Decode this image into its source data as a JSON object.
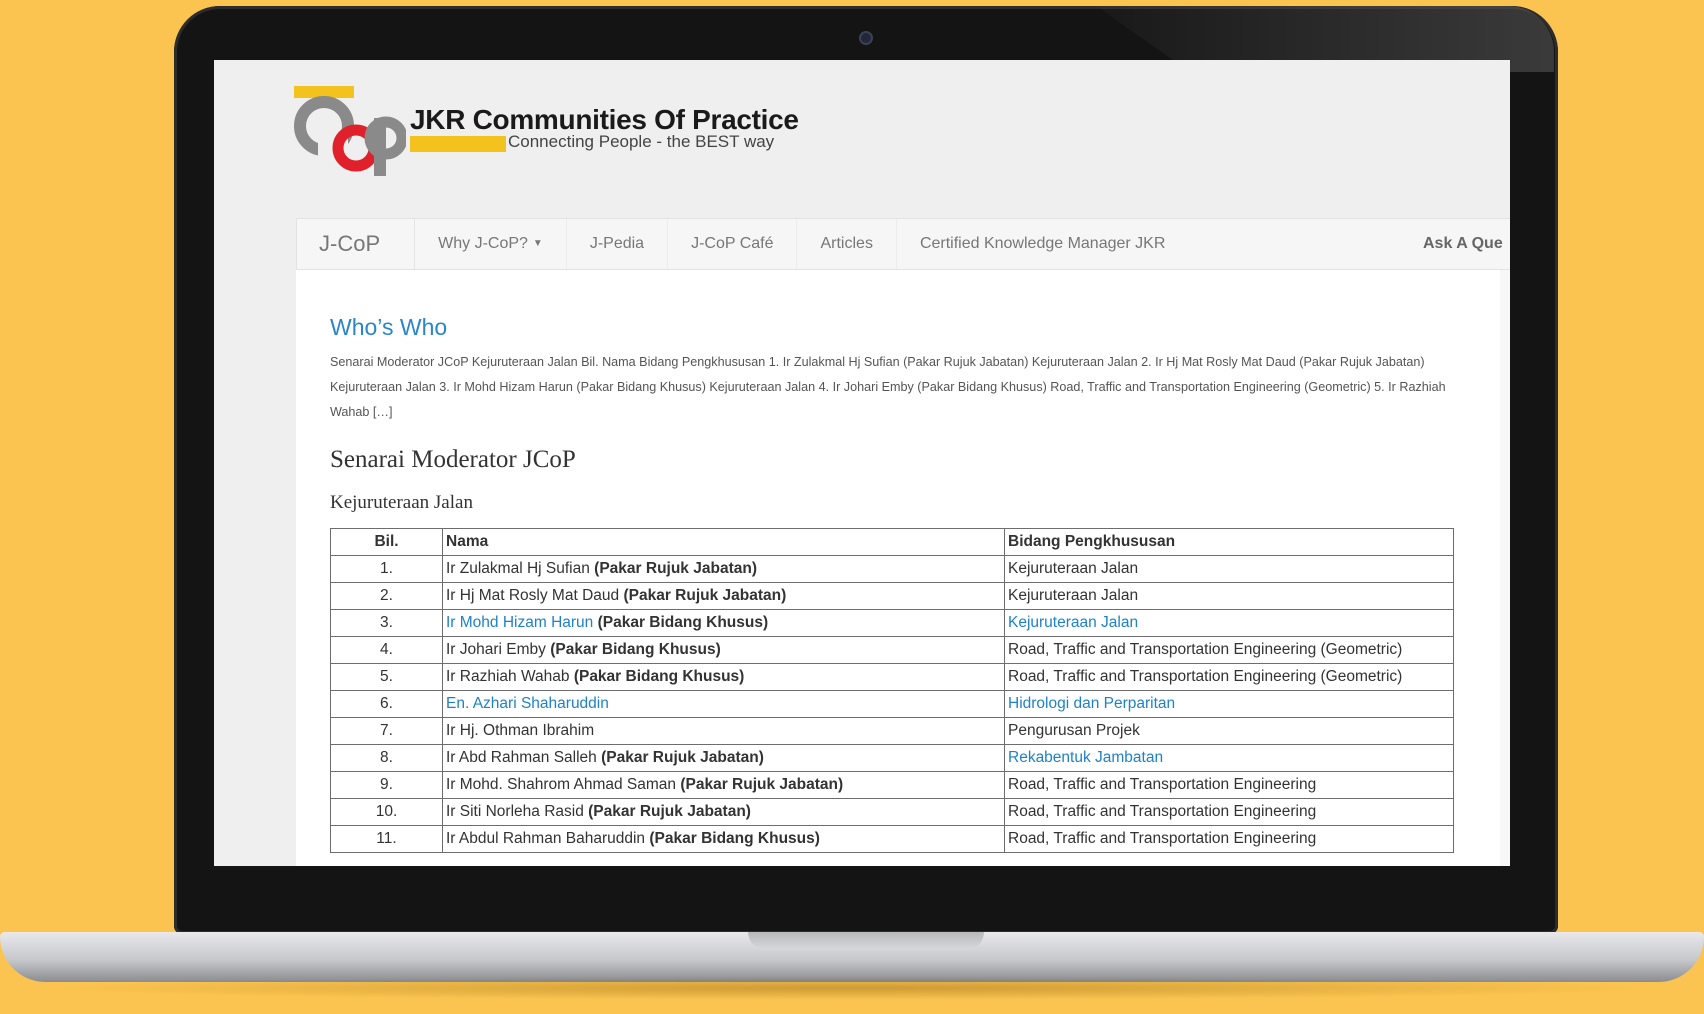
{
  "site": {
    "title": "JKR Communities Of Practice",
    "tagline": "Connecting People - the BEST way"
  },
  "nav": {
    "brand": "J-CoP",
    "items": [
      {
        "label": "Why J-CoP?",
        "dropdown": true
      },
      {
        "label": "J-Pedia"
      },
      {
        "label": "J-CoP Café"
      },
      {
        "label": "Articles"
      },
      {
        "label": "Certified Knowledge Manager JKR"
      }
    ],
    "ask": "Ask A Que"
  },
  "page": {
    "title": "Who’s Who",
    "excerpt": "Senarai Moderator JCoP Kejuruteraan Jalan Bil. Nama Bidang Pengkhususan  1. Ir Zulakmal Hj Sufian (Pakar Rujuk Jabatan) Kejuruteraan Jalan  2. Ir Hj Mat Rosly Mat Daud (Pakar Rujuk Jabatan) Kejuruteraan Jalan  3. Ir Mohd Hizam Harun (Pakar Bidang Khusus) Kejuruteraan Jalan  4. Ir Johari Emby (Pakar Bidang Khusus) Road, Traffic and Transportation Engineering (Geometric)  5. Ir Razhiah Wahab […]",
    "heading": "Senarai Moderator JCoP",
    "subheading": "Kejuruteraan Jalan"
  },
  "table": {
    "headers": [
      "Bil.",
      "Nama",
      "Bidang Pengkhususan"
    ],
    "rows": [
      {
        "bil": "1.",
        "name": "Ir Zulakmal Hj Sufian",
        "role": "(Pakar Rujuk Jabatan)",
        "field": "Kejuruteraan Jalan",
        "name_link": false,
        "field_link": false
      },
      {
        "bil": "2.",
        "name": "Ir Hj Mat Rosly Mat Daud",
        "role": "(Pakar Rujuk Jabatan)",
        "field": "Kejuruteraan Jalan",
        "name_link": false,
        "field_link": false
      },
      {
        "bil": "3.",
        "name": "Ir Mohd Hizam Harun",
        "role": "(Pakar Bidang Khusus)",
        "field": "Kejuruteraan Jalan",
        "name_link": true,
        "field_link": true
      },
      {
        "bil": "4.",
        "name": "Ir Johari Emby",
        "role": "(Pakar Bidang Khusus)",
        "field": "Road, Traffic and Transportation Engineering (Geometric)",
        "name_link": false,
        "field_link": false
      },
      {
        "bil": "5.",
        "name": "Ir Razhiah Wahab",
        "role": "(Pakar Bidang Khusus)",
        "field": "Road, Traffic and Transportation Engineering (Geometric)",
        "name_link": false,
        "field_link": false
      },
      {
        "bil": "6.",
        "name": "En. Azhari Shaharuddin",
        "role": "",
        "field": "Hidrologi dan Perparitan",
        "name_link": true,
        "field_link": true
      },
      {
        "bil": "7.",
        "name": "Ir Hj. Othman Ibrahim",
        "role": "",
        "field": "Pengurusan Projek",
        "name_link": false,
        "field_link": false
      },
      {
        "bil": "8.",
        "name": "Ir Abd Rahman Salleh",
        "role": "(Pakar Rujuk Jabatan)",
        "field": "Rekabentuk Jambatan",
        "name_link": false,
        "field_link": true
      },
      {
        "bil": "9.",
        "name": "Ir Mohd. Shahrom Ahmad Saman",
        "role": "(Pakar Rujuk Jabatan)",
        "field": "Road, Traffic and Transportation Engineering",
        "name_link": false,
        "field_link": false
      },
      {
        "bil": "10.",
        "name": "Ir Siti Norleha Rasid",
        "role": "(Pakar Rujuk Jabatan)",
        "field": "Road, Traffic and Transportation Engineering",
        "name_link": false,
        "field_link": false
      },
      {
        "bil": "11.",
        "name": "Ir Abdul Rahman Baharuddin",
        "role": "(Pakar Bidang Khusus)",
        "field": "Road, Traffic and Transportation Engineering",
        "name_link": false,
        "field_link": false
      }
    ]
  },
  "colors": {
    "background": "#fbc450",
    "link": "#1e82c9",
    "logo_yellow": "#f3c21c",
    "logo_red": "#e0202a"
  }
}
